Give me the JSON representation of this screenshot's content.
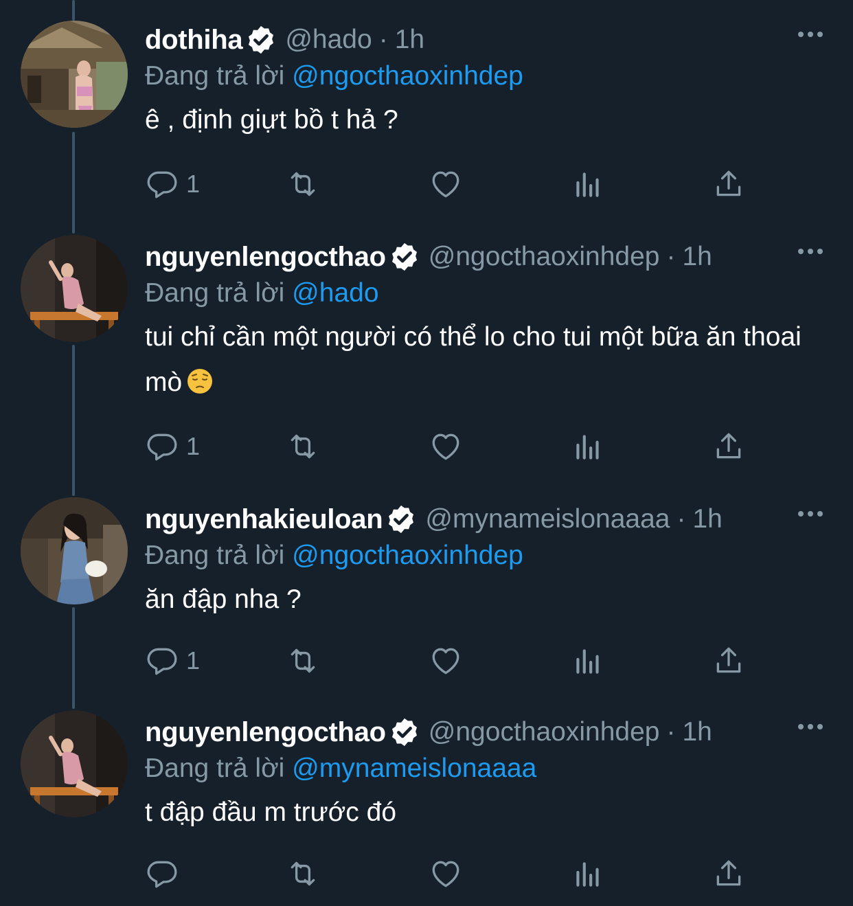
{
  "colors": {
    "background": "#15202b",
    "text_primary": "#ffffff",
    "text_secondary": "#8899a6",
    "link": "#1d9bf0",
    "thread_line": "#3d5466"
  },
  "reply_prefix": "Đang trả lời",
  "tweets": [
    {
      "display_name": "dothiha",
      "handle": "@hado",
      "separator": "·",
      "time": "1h",
      "replying_to": "@ngocthaoxinhdep",
      "text": "ê , định giựt bồ t hả ?",
      "reply_count": "1",
      "verified": true
    },
    {
      "display_name": "nguyenlengocthao",
      "handle": "@ngocthaoxinhdep",
      "separator": "·",
      "time": "1h",
      "replying_to": "@hado",
      "text": "tui chỉ cần một người có thể lo cho tui một bữa ăn thoai mò",
      "emoji": "pensive-face-emoji",
      "reply_count": "1",
      "verified": true
    },
    {
      "display_name": "nguyenhakieuloan",
      "handle": "@mynameislonaaaa",
      "separator": "·",
      "time": "1h",
      "replying_to": "@ngocthaoxinhdep",
      "text": "ăn đập nha ?",
      "reply_count": "1",
      "verified": true
    },
    {
      "display_name": "nguyenlengocthao",
      "handle": "@ngocthaoxinhdep",
      "separator": "·",
      "time": "1h",
      "replying_to": "@mynameislonaaaa",
      "text": "t đập đầu m trước đó",
      "reply_count": "",
      "verified": true
    }
  ],
  "action_icons": [
    "reply-icon",
    "retweet-icon",
    "like-icon",
    "views-icon",
    "share-icon"
  ]
}
